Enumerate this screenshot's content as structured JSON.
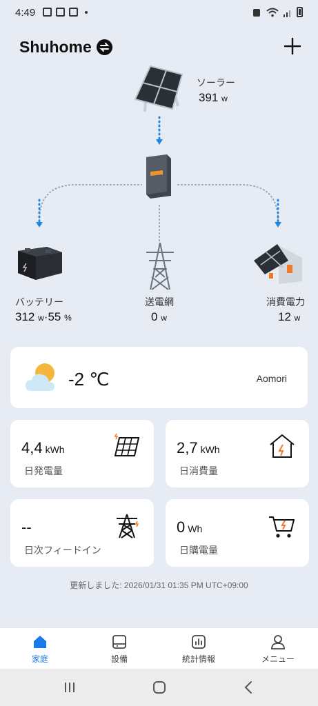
{
  "status_bar": {
    "time": "4:49"
  },
  "header": {
    "home_name": "Shuhome"
  },
  "flow": {
    "solar": {
      "label": "ソーラー",
      "value": "391",
      "unit": "w"
    },
    "battery": {
      "label": "バッテリー",
      "value": "312",
      "unit": "w",
      "sep": "·",
      "percent": "55",
      "percent_unit": "%"
    },
    "grid": {
      "label": "送電網",
      "value": "0",
      "unit": "w"
    },
    "consumption": {
      "label": "消費電力",
      "value": "12",
      "unit": "w"
    }
  },
  "weather": {
    "temperature": "-2 ℃",
    "city": "Aomori"
  },
  "stats": [
    {
      "value": "4,4",
      "unit": "kWh",
      "label": "日発電量",
      "icon": "solar-panel-icon"
    },
    {
      "value": "2,7",
      "unit": "kWh",
      "label": "日消費量",
      "icon": "house-icon"
    },
    {
      "value": "--",
      "unit": "",
      "label": "日次フィードイン",
      "icon": "transmission-tower-icon"
    },
    {
      "value": "0",
      "unit": "Wh",
      "label": "日購電量",
      "icon": "shopping-cart-icon"
    }
  ],
  "updated": "更新しました: 2026/01/31 01:35 PM UTC+09:00",
  "bottom_nav": [
    {
      "label": "家庭",
      "icon": "home-icon",
      "active": true
    },
    {
      "label": "設備",
      "icon": "device-icon",
      "active": false
    },
    {
      "label": "統計情報",
      "icon": "chart-icon",
      "active": false
    },
    {
      "label": "メニュー",
      "icon": "user-icon",
      "active": false
    }
  ],
  "colors": {
    "accent": "#1b7be8",
    "flow_arrow": "#1e88e5",
    "highlight": "#f07a2a"
  }
}
